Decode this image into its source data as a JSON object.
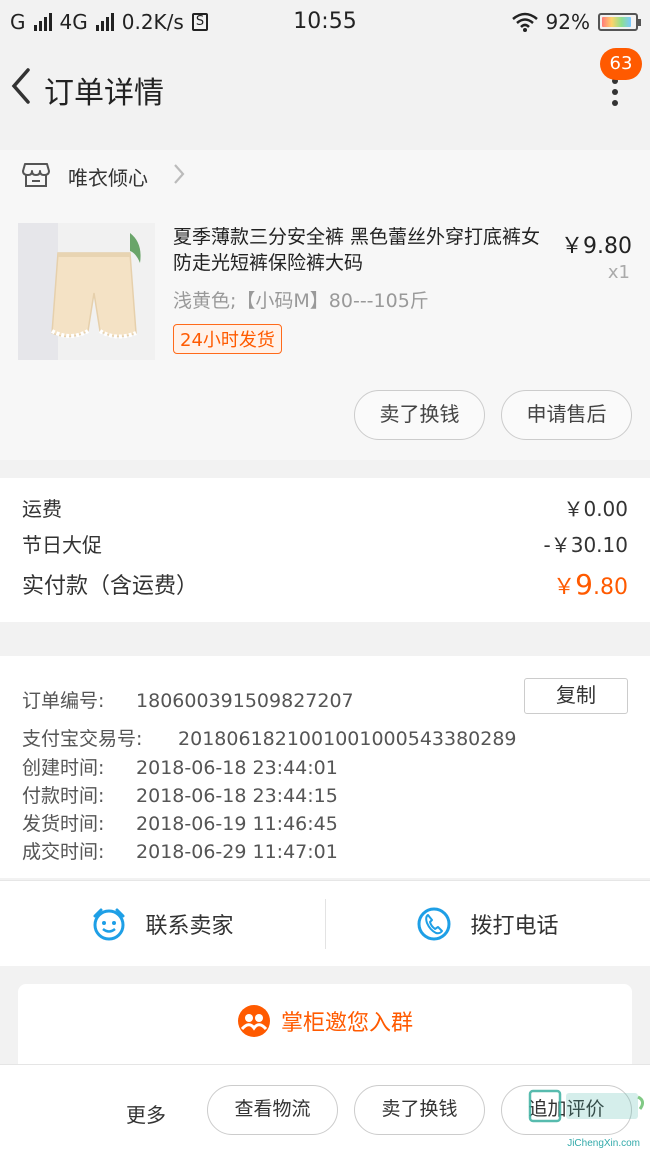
{
  "status_bar": {
    "carrier1": "G",
    "carrier2": "4G",
    "speed": "0.2K/s",
    "sim_icon": "S",
    "time": "10:55",
    "battery": "92%"
  },
  "header": {
    "title": "订单详情",
    "badge_count": "63"
  },
  "shop": {
    "name": "唯衣倾心"
  },
  "product": {
    "title": "夏季薄款三分安全裤 黑色蕾丝外穿打底裤女 防走光短裤保险裤大码",
    "spec": "浅黄色;【小码M】80---105斤",
    "tag": "24小时发货",
    "price": "￥9.80",
    "qty": "x1",
    "buttons": {
      "sell": "卖了换钱",
      "after_sale": "申请售后"
    }
  },
  "fees": {
    "shipping_label": "运费",
    "shipping_value": "￥0.00",
    "promo_label": "节日大促",
    "promo_value": "-￥30.10",
    "paid_label": "实付款（含运费）",
    "paid_currency": "￥",
    "paid_int": "9",
    "paid_dec": ".80"
  },
  "order_info": {
    "order_no_label": "订单编号:",
    "order_no": "180600391509827207",
    "copy_label": "复制",
    "alipay_label": "支付宝交易号:",
    "alipay_no": "2018061821001001000543380289",
    "created_label": "创建时间:",
    "created": "2018-06-18 23:44:01",
    "paid_label": "付款时间:",
    "paid": "2018-06-18 23:44:15",
    "shipped_label": "发货时间:",
    "shipped": "2018-06-19 11:46:45",
    "closed_label": "成交时间:",
    "closed": "2018-06-29 11:47:01"
  },
  "contact": {
    "seller": "联系卖家",
    "call": "拨打电话"
  },
  "invite": {
    "label": "掌柜邀您入群"
  },
  "bottom_bar": {
    "more": "更多",
    "logistics": "查看物流",
    "sell": "卖了换钱",
    "review": "追加评价"
  },
  "watermark": {
    "text": "JiChengXin.com"
  },
  "colors": {
    "accent": "#ff5a00",
    "contact_icon": "#1e9fe6"
  }
}
